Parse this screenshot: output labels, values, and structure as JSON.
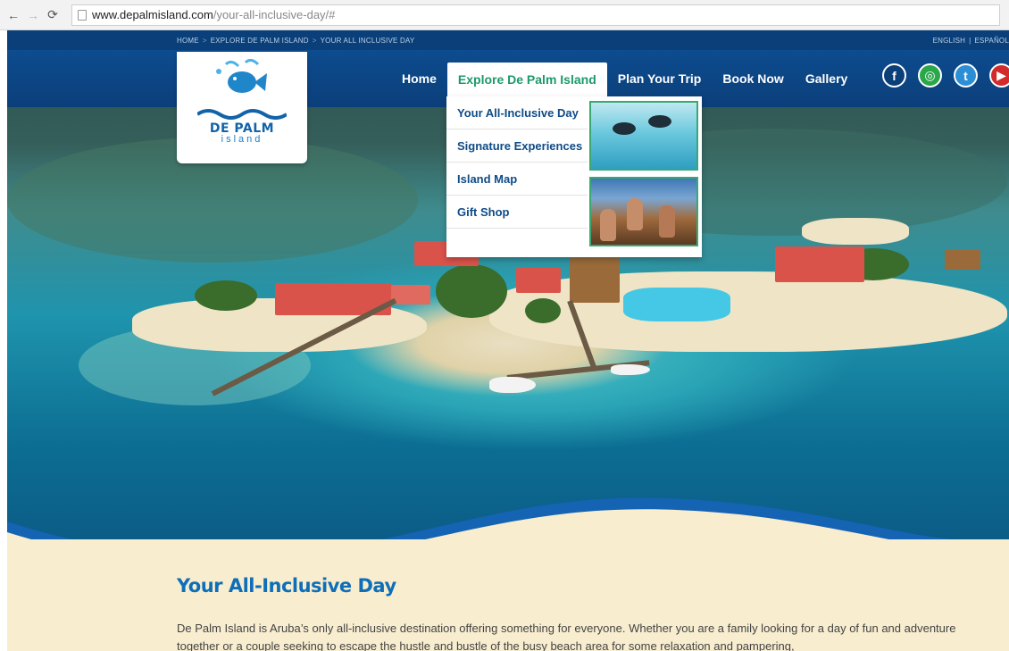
{
  "browser": {
    "url_host": "www.depalmisland.com",
    "url_path": "/your-all-inclusive-day/#"
  },
  "topbar": {
    "breadcrumbs": [
      "HOME",
      "EXPLORE DE PALM ISLAND",
      "YOUR ALL INCLUSIVE DAY"
    ],
    "crumb_sep": ">",
    "languages": [
      "ENGLISH",
      "|",
      "ESPAÑOL"
    ]
  },
  "logo": {
    "name": "DE PALM",
    "sub": "island"
  },
  "nav": {
    "items": [
      "Home",
      "Explore De Palm Island",
      "Plan Your Trip",
      "Book Now",
      "Gallery"
    ],
    "active_index": 1
  },
  "socials": [
    {
      "icon": "facebook-icon",
      "glyph": "f"
    },
    {
      "icon": "tripadvisor-icon",
      "glyph": "◎"
    },
    {
      "icon": "twitter-icon",
      "glyph": "t"
    },
    {
      "icon": "youtube-icon",
      "glyph": "▶"
    }
  ],
  "dropdown": {
    "items": [
      "Your All-Inclusive Day",
      "Signature Experiences",
      "Island Map",
      "Gift Shop"
    ]
  },
  "content": {
    "heading": "Your All-Inclusive Day",
    "paragraph": "De Palm Island is Aruba’s only all-inclusive destination offering something for everyone. Whether you are a family looking for a day of fun and adventure together or a couple seeking to escape the hustle and bustle of the busy beach area for some relaxation and pampering,"
  },
  "colors": {
    "nav_blue": "#0b3f7a",
    "active_green": "#1c9a6a",
    "heading_blue": "#0e6fb8",
    "sand": "#f8edcf"
  }
}
